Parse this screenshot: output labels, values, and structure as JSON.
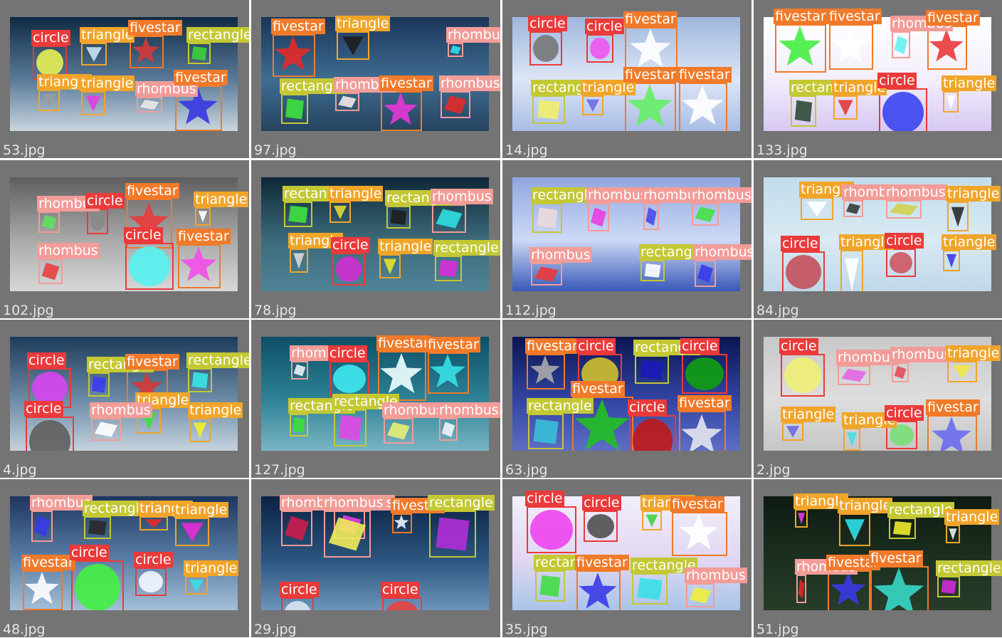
{
  "classes": {
    "circle": {
      "name": "circle",
      "color": "#ea3a3a"
    },
    "triangle": {
      "name": "triangle",
      "color": "#f0a52a"
    },
    "fivestar": {
      "name": "fivestar",
      "color": "#f07a2a"
    },
    "rectangle": {
      "name": "rectangle",
      "color": "#c3c834"
    },
    "rhombus": {
      "name": "rhombus",
      "color": "#f29c98"
    }
  },
  "tiles": [
    {
      "file": "53.jpg",
      "bg": [
        "#0f2a44",
        "#5a7a99",
        "#c9d6df"
      ],
      "dets": [
        {
          "c": "circle",
          "fill": "#e6f055"
        },
        {
          "c": "triangle",
          "fill": "#c9e4f2"
        },
        {
          "c": "fivestar",
          "fill": "#d43a3a"
        },
        {
          "c": "rectangle",
          "fill": "#3cd23c"
        },
        {
          "c": "triangle",
          "fill": "#9b9b9b"
        },
        {
          "c": "triangle",
          "fill": "#e23ee2"
        },
        {
          "c": "rhombus",
          "fill": "#e8e8e8"
        },
        {
          "c": "fivestar",
          "fill": "#3737e0"
        }
      ]
    },
    {
      "file": "97.jpg",
      "bg": [
        "#1b3658",
        "#3f6d92",
        "#26435f"
      ],
      "dets": [
        {
          "c": "fivestar",
          "fill": "#e32a2a"
        },
        {
          "c": "triangle",
          "fill": "#1d1d1d"
        },
        {
          "c": "rhombus",
          "fill": "#2ee3e8"
        },
        {
          "c": "rectangle",
          "fill": "#3de23d"
        },
        {
          "c": "rhombus",
          "fill": "#f4e6e6"
        },
        {
          "c": "fivestar",
          "fill": "#e537d5"
        },
        {
          "c": "rhombus",
          "fill": "#e22a2a"
        }
      ]
    },
    {
      "file": "14.jpg",
      "bg": [
        "#9fb7dd",
        "#dde6f6",
        "#a9bde6"
      ],
      "dets": [
        {
          "c": "circle",
          "fill": "#777777"
        },
        {
          "c": "circle",
          "fill": "#ee55ee"
        },
        {
          "c": "fivestar",
          "fill": "#ffffff"
        },
        {
          "c": "rectangle",
          "fill": "#f0f06a"
        },
        {
          "c": "triangle",
          "fill": "#6d6de8"
        },
        {
          "c": "fivestar",
          "fill": "#66ee66"
        },
        {
          "c": "fivestar",
          "fill": "#ffffff"
        }
      ]
    },
    {
      "file": "133.jpg",
      "bg": [
        "#ffffff",
        "#f3eefc",
        "#d7c8f2"
      ],
      "dets": [
        {
          "c": "fivestar",
          "fill": "#44ee44"
        },
        {
          "c": "fivestar",
          "fill": "#ffffff"
        },
        {
          "c": "rhombus",
          "fill": "#66eef0"
        },
        {
          "c": "fivestar",
          "fill": "#e83a3a"
        },
        {
          "c": "rectangle",
          "fill": "#2a4a34"
        },
        {
          "c": "triangle",
          "fill": "#e03a3a"
        },
        {
          "c": "circle",
          "fill": "#3a45f0"
        },
        {
          "c": "triangle",
          "fill": "#ffffff"
        }
      ]
    },
    {
      "file": "102.jpg",
      "bg": [
        "#5e5e5e",
        "#a9a9a9",
        "#d8d8d8"
      ],
      "dets": [
        {
          "c": "rhombus",
          "fill": "#5ee05e"
        },
        {
          "c": "circle",
          "fill": "#8a8a8a"
        },
        {
          "c": "fivestar",
          "fill": "#ea3a3a"
        },
        {
          "c": "triangle",
          "fill": "#ffffff"
        },
        {
          "c": "rhombus",
          "fill": "#e84040"
        },
        {
          "c": "circle",
          "fill": "#55f2f0"
        },
        {
          "c": "fivestar",
          "fill": "#f24ee8"
        }
      ]
    },
    {
      "file": "78.jpg",
      "bg": [
        "#0e2838",
        "#3c6a7a",
        "#4f8496"
      ],
      "dets": [
        {
          "c": "rectangle",
          "fill": "#3fe23f"
        },
        {
          "c": "triangle",
          "fill": "#e2d836"
        },
        {
          "c": "rectangle",
          "fill": "#1e1e1e"
        },
        {
          "c": "rhombus",
          "fill": "#2ee0e0"
        },
        {
          "c": "triangle",
          "fill": "#d8d8d8"
        },
        {
          "c": "circle",
          "fill": "#d22ed2"
        },
        {
          "c": "triangle",
          "fill": "#e8e22a"
        },
        {
          "c": "rectangle",
          "fill": "#d82ed8"
        }
      ]
    },
    {
      "file": "112.jpg",
      "bg": [
        "#8fa6df",
        "#cdd9f6",
        "#3858b8"
      ],
      "dets": [
        {
          "c": "rectangle",
          "fill": "#eadada"
        },
        {
          "c": "rhombus",
          "fill": "#ea3ee0"
        },
        {
          "c": "rhombus",
          "fill": "#4a4ae8"
        },
        {
          "c": "rhombus",
          "fill": "#44e044"
        },
        {
          "c": "rhombus",
          "fill": "#ea3a3a"
        },
        {
          "c": "rectangle",
          "fill": "#ffffff"
        },
        {
          "c": "rhombus",
          "fill": "#3a3ae8"
        }
      ]
    },
    {
      "file": "84.jpg",
      "bg": [
        "#c2dceb",
        "#d9eaf3",
        "#bfd8e9"
      ],
      "dets": [
        {
          "c": "triangle",
          "fill": "#ffffff"
        },
        {
          "c": "rhombus",
          "fill": "#3a3a3a"
        },
        {
          "c": "rhombus",
          "fill": "#d2d04a"
        },
        {
          "c": "triangle",
          "fill": "#2a2a2a"
        },
        {
          "c": "circle",
          "fill": "#c4505a"
        },
        {
          "c": "triangle",
          "fill": "#ffffff"
        },
        {
          "c": "circle",
          "fill": "#cd5760"
        },
        {
          "c": "triangle",
          "fill": "#3a3ae0"
        }
      ]
    },
    {
      "file": "4.jpg",
      "bg": [
        "#1e3c5a",
        "#6b8aa6",
        "#c5d2dd"
      ],
      "dets": [
        {
          "c": "circle",
          "fill": "#d845f0"
        },
        {
          "c": "rectangle",
          "fill": "#3c3cee"
        },
        {
          "c": "fivestar",
          "fill": "#d43a3a"
        },
        {
          "c": "rectangle",
          "fill": "#38e6e6"
        },
        {
          "c": "circle",
          "fill": "#5e5e5e"
        },
        {
          "c": "triangle",
          "fill": "#3ce23c"
        },
        {
          "c": "rhombus",
          "fill": "#ffffff"
        },
        {
          "c": "triangle",
          "fill": "#f0f02a"
        }
      ]
    },
    {
      "file": "127.jpg",
      "bg": [
        "#0d4f66",
        "#2e8296",
        "#7ab5c4"
      ],
      "dets": [
        {
          "c": "rhombus",
          "fill": "#e8f0f4"
        },
        {
          "c": "circle",
          "fill": "#3ee8f0"
        },
        {
          "c": "fivestar",
          "fill": "#f0ffff"
        },
        {
          "c": "fivestar",
          "fill": "#38e0e8"
        },
        {
          "c": "rectangle",
          "fill": "#3ae03a"
        },
        {
          "c": "rectangle",
          "fill": "#e047e8"
        },
        {
          "c": "rhombus",
          "fill": "#e6f072"
        },
        {
          "c": "rhombus",
          "fill": "#f0f4f8"
        }
      ]
    },
    {
      "file": "63.jpg",
      "bg": [
        "#0b1550",
        "#3244a2",
        "#5e6ec4"
      ],
      "dets": [
        {
          "c": "fivestar",
          "fill": "#aaaaaa"
        },
        {
          "c": "circle",
          "fill": "#d0c030"
        },
        {
          "c": "rectangle",
          "fill": "#1a1ab8"
        },
        {
          "c": "circle",
          "fill": "#10a010"
        },
        {
          "c": "rectangle",
          "fill": "#38c0d8"
        },
        {
          "c": "fivestar",
          "fill": "#22c022"
        },
        {
          "c": "circle",
          "fill": "#c01818"
        },
        {
          "c": "fivestar",
          "fill": "#e6e6f0"
        }
      ]
    },
    {
      "file": "2.jpg",
      "bg": [
        "#c8c8c8",
        "#dedede",
        "#c6c6c6"
      ],
      "dets": [
        {
          "c": "circle",
          "fill": "#f0f075"
        },
        {
          "c": "rhombus",
          "fill": "#e666e6"
        },
        {
          "c": "rhombus",
          "fill": "#e64e58"
        },
        {
          "c": "triangle",
          "fill": "#f0e845"
        },
        {
          "c": "triangle",
          "fill": "#6868e8"
        },
        {
          "c": "triangle",
          "fill": "#48e0e0"
        },
        {
          "c": "circle",
          "fill": "#78e078"
        },
        {
          "c": "fivestar",
          "fill": "#6b6bf0"
        }
      ]
    },
    {
      "file": "48.jpg",
      "bg": [
        "#1c3660",
        "#5b7ea6",
        "#a4bfd8"
      ],
      "dets": [
        {
          "c": "rhombus",
          "fill": "#3a3ae6"
        },
        {
          "c": "rectangle",
          "fill": "#2a2a2a"
        },
        {
          "c": "triangle",
          "fill": "#e82a2a"
        },
        {
          "c": "triangle",
          "fill": "#e82ad8"
        },
        {
          "c": "fivestar",
          "fill": "#ffffff"
        },
        {
          "c": "circle",
          "fill": "#44f044"
        },
        {
          "c": "circle",
          "fill": "#f4f8ff"
        },
        {
          "c": "triangle",
          "fill": "#3ae0e8"
        }
      ]
    },
    {
      "file": "29.jpg",
      "bg": [
        "#0c2244",
        "#2a547e",
        "#6d95bb"
      ],
      "dets": [
        {
          "c": "rhombus",
          "fill": "#cc1e4e"
        },
        {
          "c": "rhombus",
          "fill": "#e23ee2"
        },
        {
          "c": "fivestar",
          "fill": "#e8f4f8"
        },
        {
          "c": "rectangle",
          "fill": "#b12ed8"
        },
        {
          "c": "circle",
          "fill": "#d8e6f4"
        },
        {
          "c": "rhombus",
          "fill": "#f0ec5a"
        },
        {
          "c": "circle",
          "fill": "#ea4040"
        }
      ]
    },
    {
      "file": "35.jpg",
      "bg": [
        "#f2eefa",
        "#e2d7f3",
        "#a9c5e8"
      ],
      "dets": [
        {
          "c": "circle",
          "fill": "#ee44ee"
        },
        {
          "c": "circle",
          "fill": "#505050"
        },
        {
          "c": "triangle",
          "fill": "#3ed23e"
        },
        {
          "c": "fivestar",
          "fill": "#ffffff"
        },
        {
          "c": "rectangle",
          "fill": "#44dd44"
        },
        {
          "c": "fivestar",
          "fill": "#3a3ae6"
        },
        {
          "c": "rectangle",
          "fill": "#38e0e8"
        },
        {
          "c": "rhombus",
          "fill": "#f0f03a"
        }
      ]
    },
    {
      "file": "51.jpg",
      "bg": [
        "#0f1a12",
        "#1c3020",
        "#283c2a"
      ],
      "dets": [
        {
          "c": "triangle",
          "fill": "#e23ee2"
        },
        {
          "c": "triangle",
          "fill": "#2ee0e8"
        },
        {
          "c": "rectangle",
          "fill": "#f0ec2a"
        },
        {
          "c": "triangle",
          "fill": "#e8f0f0"
        },
        {
          "c": "rhombus",
          "fill": "#e02a2a"
        },
        {
          "c": "fivestar",
          "fill": "#3a3ae6"
        },
        {
          "c": "fivestar",
          "fill": "#38d8c8"
        },
        {
          "c": "rectangle",
          "fill": "#d02ad8"
        }
      ]
    }
  ]
}
